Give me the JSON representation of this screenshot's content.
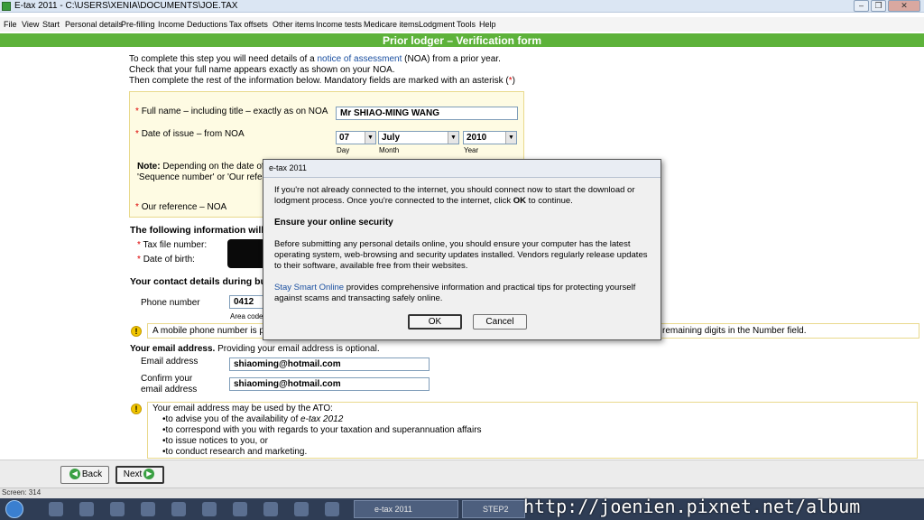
{
  "window": {
    "title": "E-tax 2011 - C:\\USERS\\XENIA\\DOCUMENTS\\JOE.TAX",
    "minimize": "–",
    "restore": "❐",
    "close": "✕"
  },
  "menu": [
    "File",
    "View",
    "Start",
    "Personal details",
    "Pre-filling",
    "Income",
    "Deductions",
    "Tax offsets",
    "Other items",
    "Income tests",
    "Medicare items",
    "Lodgment",
    "Tools",
    "Help"
  ],
  "page": {
    "title": "Prior lodger – Verification form"
  },
  "intro": {
    "line1_pre": "To complete this step you will need details of a ",
    "line1_link": "notice of assessment",
    "line1_post": " (NOA) from a prior year.",
    "line2": "Check that your full name appears exactly as shown on your NOA.",
    "line3_pre": "Then complete the rest of the information below. Mandatory fields are marked with an asterisk (",
    "line3_star": "*",
    "line3_post": ")"
  },
  "noa": {
    "fullname_label": "Full name – including title – exactly as on NOA",
    "fullname_value": "Mr SHIAO-MING WANG",
    "date_label": "Date of issue – from NOA",
    "day_value": "07",
    "month_value": "July",
    "year_value": "2010",
    "day_caption": "Day",
    "month_caption": "Month",
    "year_caption": "Year",
    "note_label": "Note:",
    "note_text": "Depending on the date of",
    "note_line2": "'Sequence number' or 'Our refere",
    "ourref_label": "Our reference – NOA"
  },
  "personal": {
    "heading": "The following information will",
    "tfn_label": "Tax file number:",
    "dob_label": "Date of birth:"
  },
  "contact": {
    "heading": "Your contact details during bus",
    "phone_label": "Phone number",
    "phone_area": "0412",
    "area_caption": "Area code",
    "mobile_note": "A mobile phone number is pr",
    "mobile_note_tail": "remaining digits in the Number field."
  },
  "email": {
    "heading_bold": "Your email address.",
    "heading_rest": " Providing your email address is optional.",
    "email_label": "Email address",
    "email_value": "shiaoming@hotmail.com",
    "confirm_label_1": "Confirm your",
    "confirm_label_2": "email address",
    "confirm_value": "shiaoming@hotmail.com",
    "note_intro": "Your email address may be used by the ATO:",
    "note_items": [
      "•to advise you of the availability of ",
      "•to correspond with you with regards to your taxation and superannuation affairs",
      "•to issue notices to you, or",
      "•to conduct research and marketing."
    ],
    "note_item1_em": "e-tax 2012"
  },
  "nav": {
    "back": "Back",
    "next": "Next"
  },
  "status": {
    "text": "Screen: 314"
  },
  "dialog": {
    "title": "e-tax 2011",
    "para1_pre": "If you're not already connected to the internet, you should connect now to start the download or lodgment process. Once you're connected to the internet, click ",
    "para1_ok": "OK",
    "para1_post": " to continue.",
    "heading": "Ensure your online security",
    "para2": "Before submitting any personal details online, you should ensure your computer has the latest operating system, web-browsing and security updates installed. Vendors regularly release updates to their software, available free from their websites.",
    "para3_link": "Stay Smart Online",
    "para3_rest": " provides comprehensive information and practical tips for protecting yourself against scams and transacting safely online.",
    "ok": "OK",
    "cancel": "Cancel"
  },
  "taskbar": {
    "task1": "e-tax 2011",
    "task2": "STEP2"
  },
  "watermark": "http://joenien.pixnet.net/album"
}
